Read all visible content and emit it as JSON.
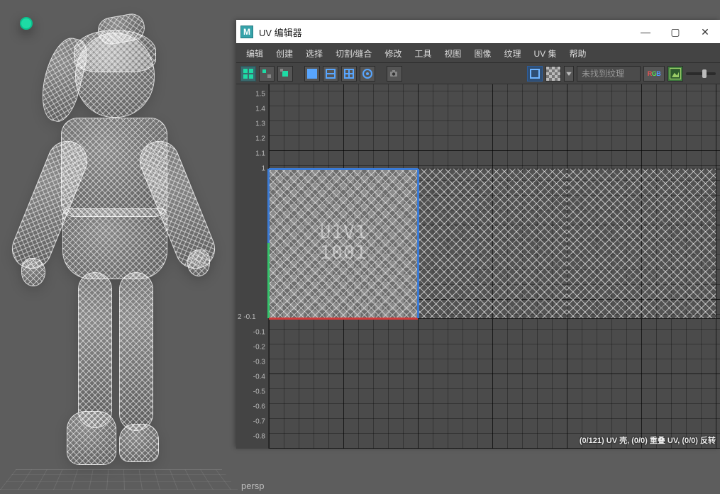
{
  "viewport": {
    "camera_label": "persp"
  },
  "uv_editor": {
    "window_title": "UV 编辑器",
    "app_icon": "M",
    "window_buttons": {
      "minimize": "—",
      "maximize": "▢",
      "close": "✕"
    },
    "menu": [
      "编辑",
      "创建",
      "选择",
      "切割/缝合",
      "修改",
      "工具",
      "视图",
      "图像",
      "纹理",
      "UV 集",
      "帮助"
    ],
    "toolbar_icons": [
      "uv-grid-icon",
      "uv-shell-icon",
      "uv-snap-icon",
      "sel-mode-a-icon",
      "sel-mode-b-icon",
      "sel-mode-c-icon",
      "sel-mode-d-icon",
      "camera-icon"
    ],
    "right_tools": {
      "display_toggle_a": "blue-frame-icon",
      "display_toggle_b": "checker-icon",
      "texture_input": "未找到纹理",
      "rgb_toggle": "RGB",
      "image_toggle": "image-icon"
    },
    "ruler_y": [
      "1.5",
      "1.4",
      "1.3",
      "1.2",
      "1.1",
      "1",
      "-0.1",
      "-0.2",
      "-0.3",
      "-0.4",
      "-0.5",
      "-0.6",
      "-0.7",
      "-0.8"
    ],
    "corner_label": "2 -0.1",
    "tile0_label_top": "U1V1",
    "tile0_label_bot": "1001",
    "status": "(0/121) UV 壳, (0/0) 重叠 UV, (0/0) 反转"
  }
}
